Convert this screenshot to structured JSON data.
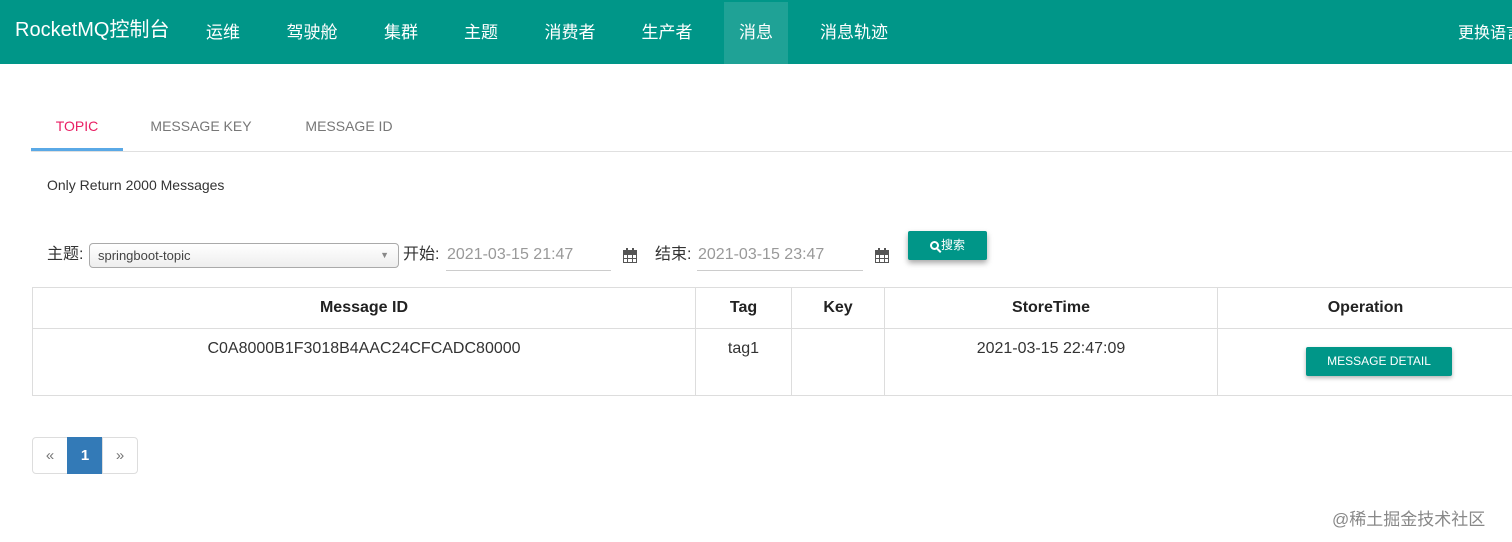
{
  "navbar": {
    "brand": "RocketMQ控制台",
    "items": [
      "运维",
      "驾驶舱",
      "集群",
      "主题",
      "消费者",
      "生产者",
      "消息",
      "消息轨迹"
    ],
    "active_item": "消息",
    "language_label": "更换语言"
  },
  "tabs": [
    {
      "label": "TOPIC",
      "active": true
    },
    {
      "label": "MESSAGE KEY",
      "active": false
    },
    {
      "label": "MESSAGE ID",
      "active": false
    }
  ],
  "notice": "Only Return 2000 Messages",
  "filter": {
    "topic_label": "主题:",
    "topic_value": "springboot-topic",
    "start_label": "开始:",
    "start_value": "2021-03-15 21:47",
    "end_label": "结束:",
    "end_value": "2021-03-15 23:47",
    "search_label": "搜索"
  },
  "table": {
    "headers": [
      "Message ID",
      "Tag",
      "Key",
      "StoreTime",
      "Operation"
    ],
    "rows": [
      {
        "message_id": "C0A8000B1F3018B4AAC24CFCADC80000",
        "tag": "tag1",
        "key": "",
        "store_time": "2021-03-15 22:47:09",
        "operation_label": "MESSAGE DETAIL"
      }
    ]
  },
  "pagination": {
    "prev": "«",
    "current": "1",
    "next": "»"
  },
  "watermark": "@稀土掘金技术社区",
  "colors": {
    "primary": "#009688",
    "active_tab": "#e91e63",
    "tab_underline": "#5aa9e6",
    "page_active": "#337ab7"
  }
}
